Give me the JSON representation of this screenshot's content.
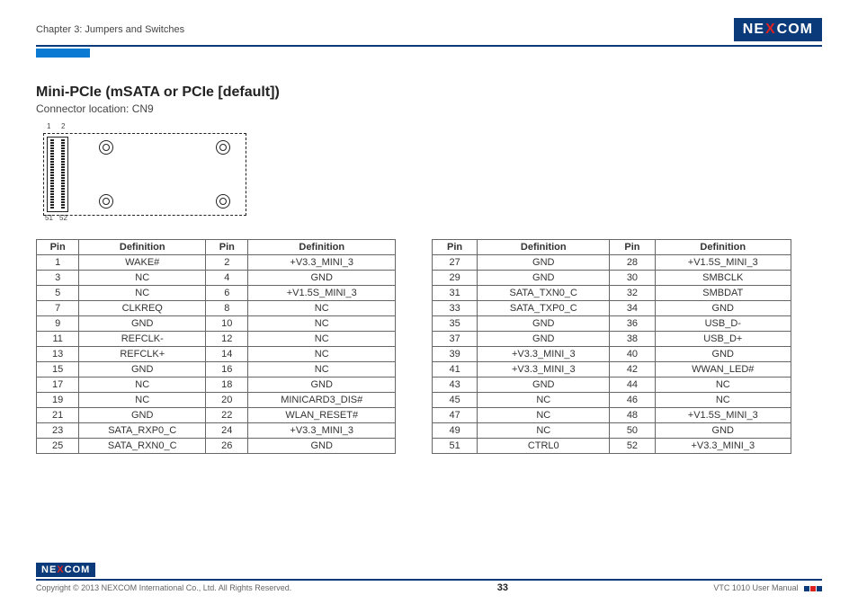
{
  "header": {
    "chapter": "Chapter 3: Jumpers and Switches",
    "logo_pre": "NE",
    "logo_x": "X",
    "logo_post": "COM"
  },
  "content": {
    "title": "Mini-PCIe (mSATA or PCIe [default])",
    "subtitle": "Connector location: CN9",
    "diag_labels": {
      "tl": "1",
      "tr": "2",
      "bl": "51",
      "br": "52"
    }
  },
  "table_headers": {
    "pin": "Pin",
    "def": "Definition"
  },
  "table1": [
    {
      "p1": "1",
      "d1": "WAKE#",
      "p2": "2",
      "d2": "+V3.3_MINI_3"
    },
    {
      "p1": "3",
      "d1": "NC",
      "p2": "4",
      "d2": "GND"
    },
    {
      "p1": "5",
      "d1": "NC",
      "p2": "6",
      "d2": "+V1.5S_MINI_3"
    },
    {
      "p1": "7",
      "d1": "CLKREQ",
      "p2": "8",
      "d2": "NC"
    },
    {
      "p1": "9",
      "d1": "GND",
      "p2": "10",
      "d2": "NC"
    },
    {
      "p1": "11",
      "d1": "REFCLK-",
      "p2": "12",
      "d2": "NC"
    },
    {
      "p1": "13",
      "d1": "REFCLK+",
      "p2": "14",
      "d2": "NC"
    },
    {
      "p1": "15",
      "d1": "GND",
      "p2": "16",
      "d2": "NC"
    },
    {
      "p1": "17",
      "d1": "NC",
      "p2": "18",
      "d2": "GND"
    },
    {
      "p1": "19",
      "d1": "NC",
      "p2": "20",
      "d2": "MINICARD3_DIS#"
    },
    {
      "p1": "21",
      "d1": "GND",
      "p2": "22",
      "d2": "WLAN_RESET#"
    },
    {
      "p1": "23",
      "d1": "SATA_RXP0_C",
      "p2": "24",
      "d2": "+V3.3_MINI_3"
    },
    {
      "p1": "25",
      "d1": "SATA_RXN0_C",
      "p2": "26",
      "d2": "GND"
    }
  ],
  "table2": [
    {
      "p1": "27",
      "d1": "GND",
      "p2": "28",
      "d2": "+V1.5S_MINI_3"
    },
    {
      "p1": "29",
      "d1": "GND",
      "p2": "30",
      "d2": "SMBCLK"
    },
    {
      "p1": "31",
      "d1": "SATA_TXN0_C",
      "p2": "32",
      "d2": "SMBDAT"
    },
    {
      "p1": "33",
      "d1": "SATA_TXP0_C",
      "p2": "34",
      "d2": "GND"
    },
    {
      "p1": "35",
      "d1": "GND",
      "p2": "36",
      "d2": "USB_D-"
    },
    {
      "p1": "37",
      "d1": "GND",
      "p2": "38",
      "d2": "USB_D+"
    },
    {
      "p1": "39",
      "d1": "+V3.3_MINI_3",
      "p2": "40",
      "d2": "GND"
    },
    {
      "p1": "41",
      "d1": "+V3.3_MINI_3",
      "p2": "42",
      "d2": "WWAN_LED#"
    },
    {
      "p1": "43",
      "d1": "GND",
      "p2": "44",
      "d2": "NC"
    },
    {
      "p1": "45",
      "d1": "NC",
      "p2": "46",
      "d2": "NC"
    },
    {
      "p1": "47",
      "d1": "NC",
      "p2": "48",
      "d2": "+V1.5S_MINI_3"
    },
    {
      "p1": "49",
      "d1": "NC",
      "p2": "50",
      "d2": "GND"
    },
    {
      "p1": "51",
      "d1": "CTRL0",
      "p2": "52",
      "d2": "+V3.3_MINI_3"
    }
  ],
  "footer": {
    "copyright": "Copyright © 2013 NEXCOM International Co., Ltd. All Rights Reserved.",
    "page": "33",
    "manual": "VTC 1010 User Manual"
  }
}
